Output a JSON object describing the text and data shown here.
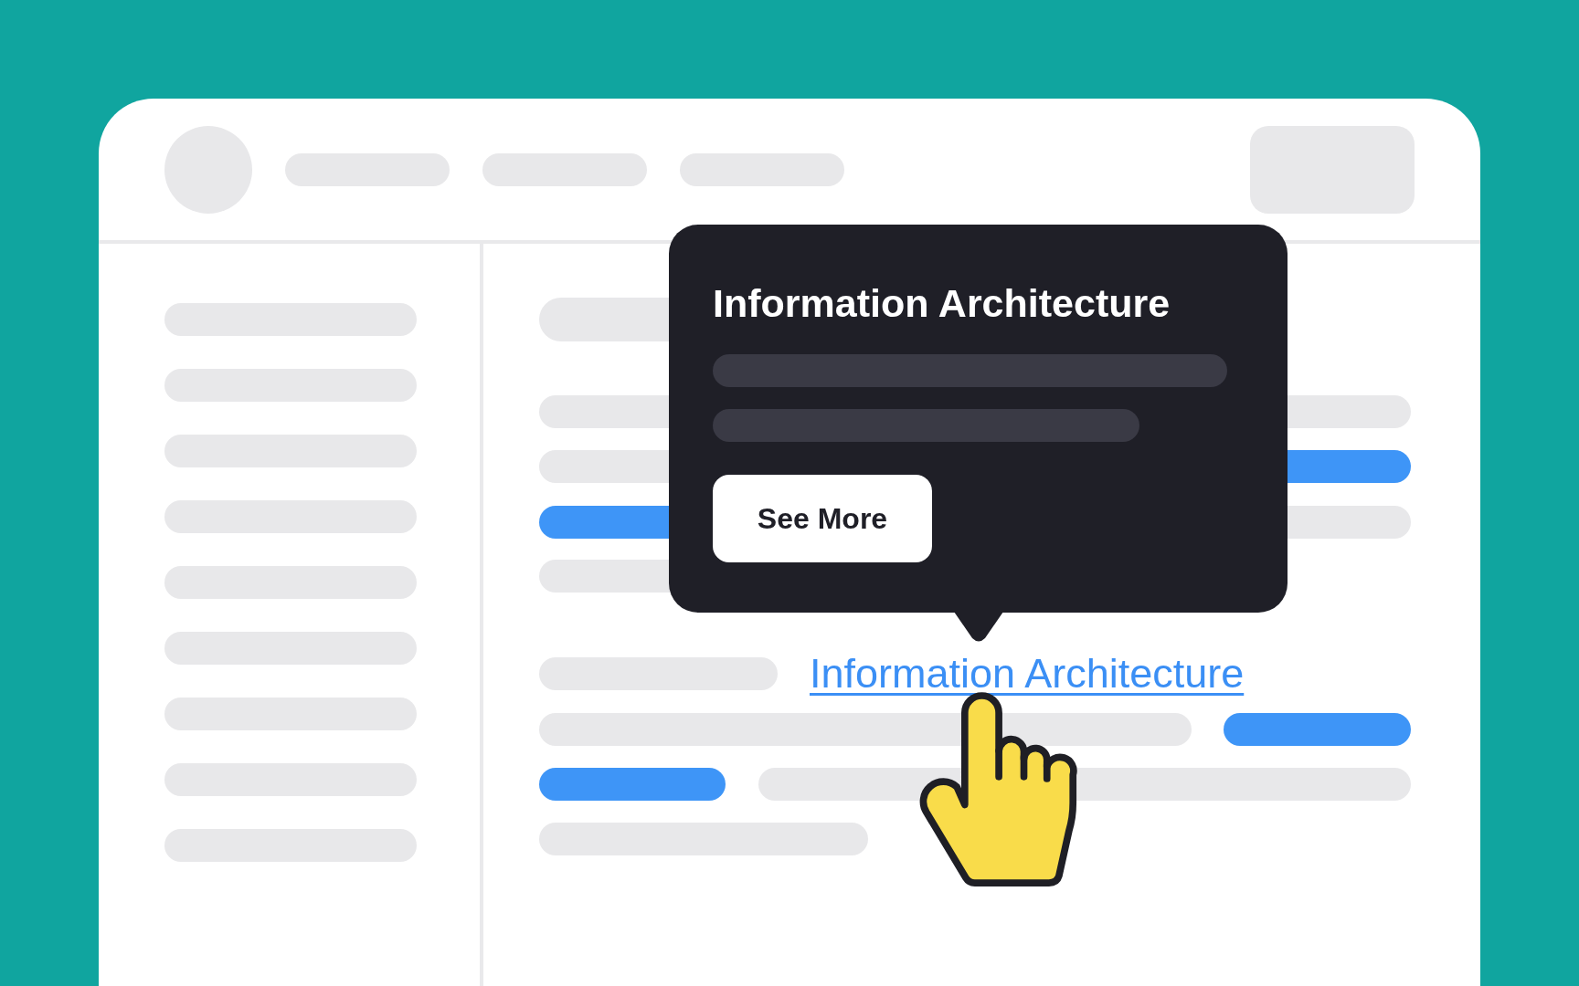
{
  "tooltip": {
    "title": "Information Architecture",
    "button": "See More"
  },
  "link": {
    "text": "Information Architecture"
  }
}
